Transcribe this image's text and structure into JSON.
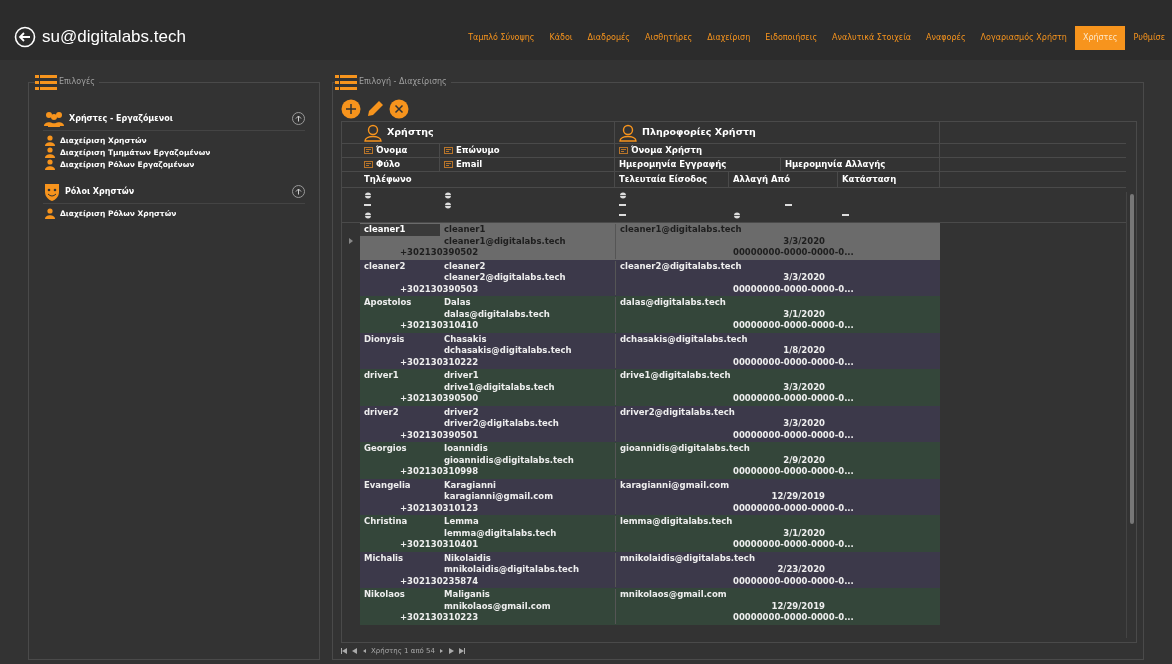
{
  "header": {
    "title": "su@digitalabs.tech"
  },
  "nav": [
    {
      "label": "Ταμπλό Σύνοψης",
      "selected": false
    },
    {
      "label": "Κάδοι",
      "selected": false
    },
    {
      "label": "Διαδρομές",
      "selected": false
    },
    {
      "label": "Αισθητήρες",
      "selected": false
    },
    {
      "label": "Διαχείριση",
      "selected": false
    },
    {
      "label": "Ειδοποιήσεις",
      "selected": false
    },
    {
      "label": "Αναλυτικά Στοιχεία",
      "selected": false
    },
    {
      "label": "Αναφορές",
      "selected": false
    },
    {
      "label": "Λογαριασμός Χρήστη",
      "selected": false
    },
    {
      "label": "Χρήστες",
      "selected": true
    },
    {
      "label": "Ρυθμίσε",
      "selected": false
    }
  ],
  "sidebar": {
    "title": "Επιλογές",
    "sections": [
      {
        "title": "Χρήστες - Εργαζόμενοι",
        "expanded": true,
        "items": [
          "Διαχείριση Χρηστών",
          "Διαχείριση Τμημάτων Εργαζομένων",
          "Διαχείριση Ρόλων Εργαζομένων"
        ]
      },
      {
        "title": "Ρόλοι Χρηστών",
        "expanded": true,
        "items": [
          "Διαχείριση Ρόλων Χρηστών"
        ]
      }
    ]
  },
  "main": {
    "title": "Επιλογή - Διαχείρισης",
    "bands": [
      "Χρήστης",
      "Πληροφορίες Χρήστη"
    ],
    "columns": {
      "first_name": "Όνομα",
      "last_name": "Επώνυμο",
      "username": "Όνομα Χρήστη",
      "gender": "Φύλο",
      "email": "Email",
      "registered": "Ημερομηνία Εγγραφής",
      "changed": "Ημερομηνία Αλλαγής",
      "phone": "Τηλέφωνο",
      "last_login": "Τελευταία Είσοδος",
      "changed_by": "Αλλαγή Από",
      "status": "Κατάσταση"
    },
    "rows": [
      {
        "first_name": "cleaner1",
        "last_name": "cleaner1",
        "email": "cleaner1@digitalabs.tech",
        "phone": "+302130390502",
        "username": "cleaner1@digitalabs.tech",
        "registered": "3/3/2020",
        "changed_by": "00000000-0000-0000-0...",
        "selected": true
      },
      {
        "first_name": "cleaner2",
        "last_name": "cleaner2",
        "email": "cleaner2@digitalabs.tech",
        "phone": "+302130390503",
        "username": "cleaner2@digitalabs.tech",
        "registered": "3/3/2020",
        "changed_by": "00000000-0000-0000-0...",
        "selected": false
      },
      {
        "first_name": "Apostolos",
        "last_name": "Dalas",
        "email": "dalas@digitalabs.tech",
        "phone": "+302130310410",
        "username": "dalas@digitalabs.tech",
        "registered": "3/1/2020",
        "changed_by": "00000000-0000-0000-0...",
        "selected": false
      },
      {
        "first_name": "Dionysis",
        "last_name": "Chasakis",
        "email": "dchasakis@digitalabs.tech",
        "phone": "+302130310222",
        "username": "dchasakis@digitalabs.tech",
        "registered": "1/8/2020",
        "changed_by": "00000000-0000-0000-0...",
        "selected": false
      },
      {
        "first_name": "driver1",
        "last_name": "driver1",
        "email": "drive1@digitalabs.tech",
        "phone": "+302130390500",
        "username": "drive1@digitalabs.tech",
        "registered": "3/3/2020",
        "changed_by": "00000000-0000-0000-0...",
        "selected": false
      },
      {
        "first_name": "driver2",
        "last_name": "driver2",
        "email": "driver2@digitalabs.tech",
        "phone": "+302130390501",
        "username": "driver2@digitalabs.tech",
        "registered": "3/3/2020",
        "changed_by": "00000000-0000-0000-0...",
        "selected": false
      },
      {
        "first_name": "Georgios",
        "last_name": "Ioannidis",
        "email": "gioannidis@digitalabs.tech",
        "phone": "+302130310998",
        "username": "gioannidis@digitalabs.tech",
        "registered": "2/9/2020",
        "changed_by": "00000000-0000-0000-0...",
        "selected": false
      },
      {
        "first_name": "Evangelia",
        "last_name": "Karagianni",
        "email": "karagianni@gmail.com",
        "phone": "+302130310123",
        "username": "karagianni@gmail.com",
        "registered": "12/29/2019",
        "changed_by": "00000000-0000-0000-0...",
        "selected": false
      },
      {
        "first_name": "Christina",
        "last_name": "Lemma",
        "email": "lemma@digitalabs.tech",
        "phone": "+302130310401",
        "username": "lemma@digitalabs.tech",
        "registered": "3/1/2020",
        "changed_by": "00000000-0000-0000-0...",
        "selected": false
      },
      {
        "first_name": "Michalis",
        "last_name": "Nikolaidis",
        "email": "mnikolaidis@digitalabs.tech",
        "phone": "+302130235874",
        "username": "mnikolaidis@digitalabs.tech",
        "registered": "2/23/2020",
        "changed_by": "00000000-0000-0000-0...",
        "selected": false
      },
      {
        "first_name": "Nikolaos",
        "last_name": "Maliganis",
        "email": "mnikolaos@gmail.com",
        "phone": "+302130310223",
        "username": "mnikolaos@gmail.com",
        "registered": "12/29/2019",
        "changed_by": "00000000-0000-0000-0...",
        "selected": false
      }
    ],
    "pager": "Χρήστης 1 από 54"
  }
}
